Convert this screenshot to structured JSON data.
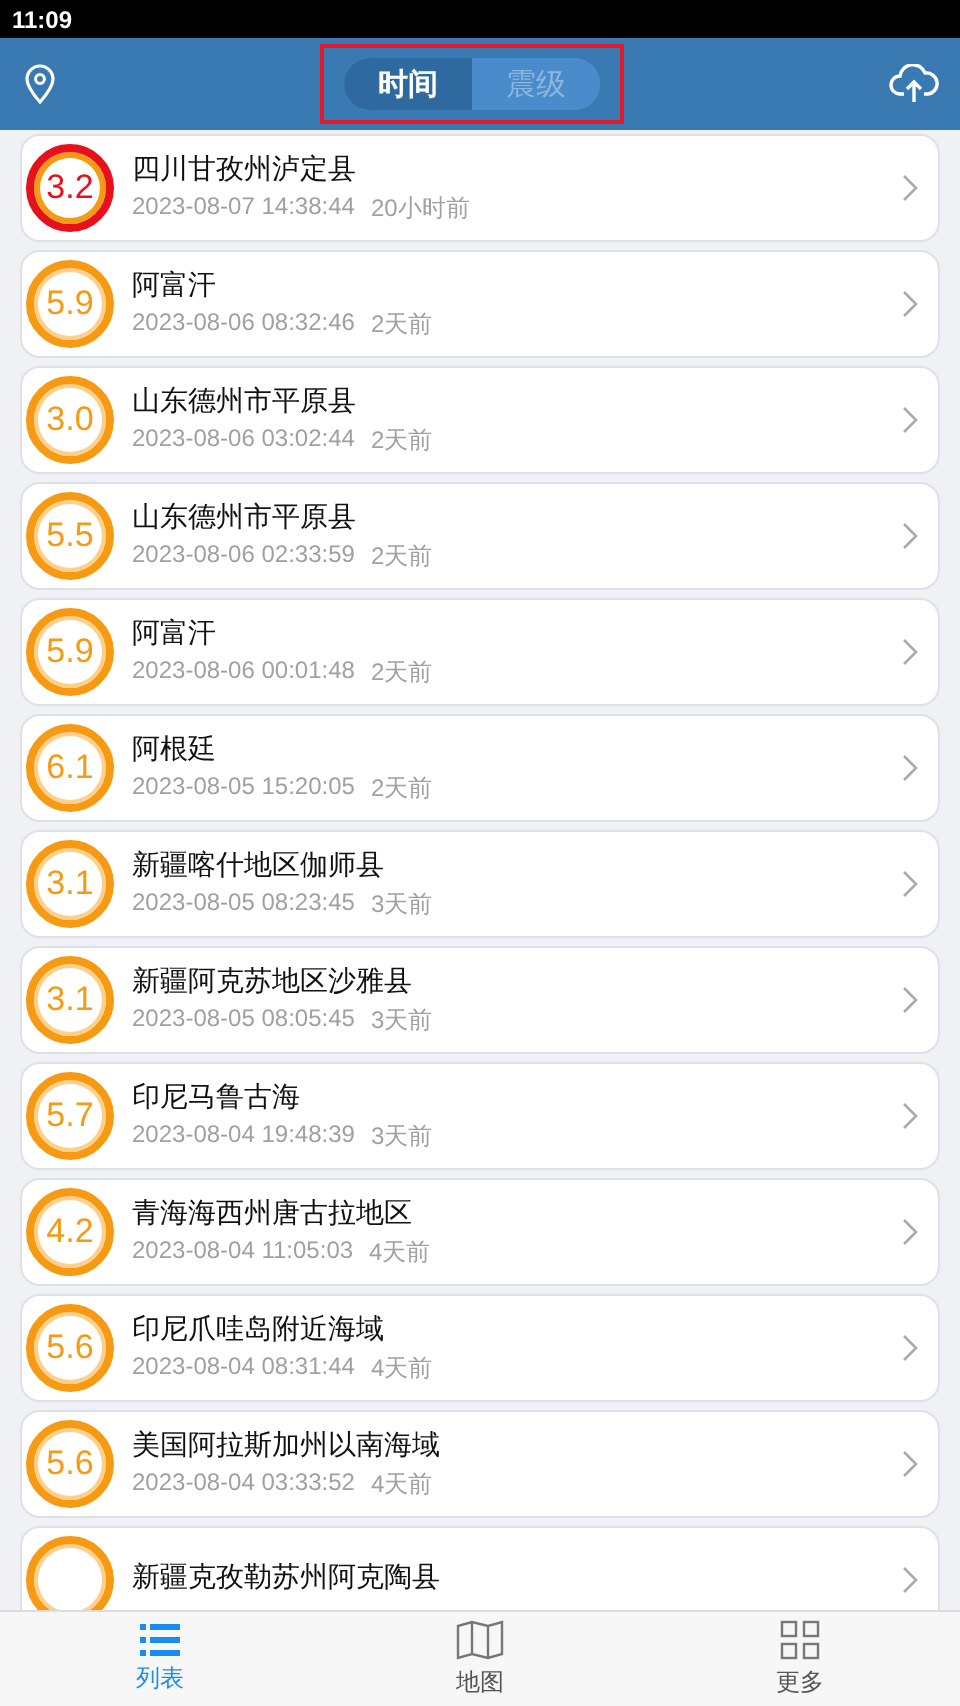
{
  "status_bar": {
    "time": "11:09"
  },
  "header": {
    "segments": [
      {
        "label": "时间",
        "selected": true
      },
      {
        "label": "震级",
        "selected": false
      }
    ]
  },
  "quakes": [
    {
      "magnitude": "3.2",
      "color": "#e8101a",
      "place": "四川甘孜州泸定县",
      "time": "2023-08-07 14:38:44",
      "ago": "20小时前"
    },
    {
      "magnitude": "5.9",
      "color": "#f59a12",
      "place": "阿富汗",
      "time": "2023-08-06 08:32:46",
      "ago": "2天前"
    },
    {
      "magnitude": "3.0",
      "color": "#f59a12",
      "place": "山东德州市平原县",
      "time": "2023-08-06 03:02:44",
      "ago": "2天前"
    },
    {
      "magnitude": "5.5",
      "color": "#f59a12",
      "place": "山东德州市平原县",
      "time": "2023-08-06 02:33:59",
      "ago": "2天前"
    },
    {
      "magnitude": "5.9",
      "color": "#f59a12",
      "place": "阿富汗",
      "time": "2023-08-06 00:01:48",
      "ago": "2天前"
    },
    {
      "magnitude": "6.1",
      "color": "#f59a12",
      "place": "阿根廷",
      "time": "2023-08-05 15:20:05",
      "ago": "2天前"
    },
    {
      "magnitude": "3.1",
      "color": "#f59a12",
      "place": "新疆喀什地区伽师县",
      "time": "2023-08-05 08:23:45",
      "ago": "3天前"
    },
    {
      "magnitude": "3.1",
      "color": "#f59a12",
      "place": "新疆阿克苏地区沙雅县",
      "time": "2023-08-05 08:05:45",
      "ago": "3天前"
    },
    {
      "magnitude": "5.7",
      "color": "#f59a12",
      "place": "印尼马鲁古海",
      "time": "2023-08-04 19:48:39",
      "ago": "3天前"
    },
    {
      "magnitude": "4.2",
      "color": "#f59a12",
      "place": "青海海西州唐古拉地区",
      "time": "2023-08-04 11:05:03",
      "ago": "4天前"
    },
    {
      "magnitude": "5.6",
      "color": "#f59a12",
      "place": "印尼爪哇岛附近海域",
      "time": "2023-08-04 08:31:44",
      "ago": "4天前"
    },
    {
      "magnitude": "5.6",
      "color": "#f59a12",
      "place": "美国阿拉斯加州以南海域",
      "time": "2023-08-04 03:33:52",
      "ago": "4天前"
    },
    {
      "color": "#f59a12",
      "place": "新疆克孜勒苏州阿克陶县"
    }
  ],
  "tabs": [
    {
      "kind": "list",
      "label": "列表",
      "selected": true
    },
    {
      "kind": "map",
      "label": "地图",
      "selected": false
    },
    {
      "kind": "more",
      "label": "更多",
      "selected": false
    }
  ]
}
